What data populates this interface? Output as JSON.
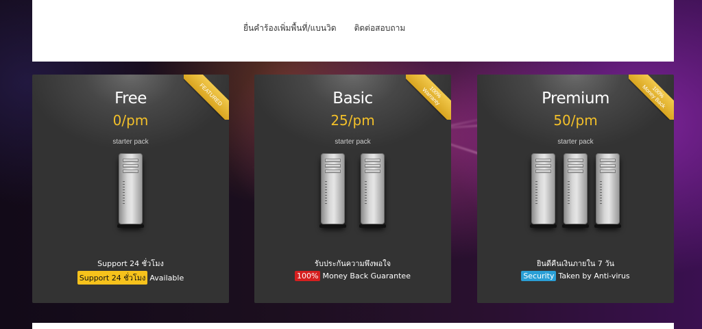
{
  "nav": {
    "items": [
      {
        "label": "ยื่นคำร้องเพิ่มพื้นที่/แบนวิด"
      },
      {
        "label": "ติดต่อสอบถาม"
      }
    ]
  },
  "plans": [
    {
      "name": "Free",
      "price": "0/pm",
      "subtitle": "starter pack",
      "ribbon": [
        "FEATURED"
      ],
      "servers": 1,
      "line1": "Support 24 ชั่วโมง",
      "badge": "Support 24 ชั่วโมง",
      "badge_color": "#f6c21c",
      "line2_rest": "Available"
    },
    {
      "name": "Basic",
      "price": "25/pm",
      "subtitle": "starter pack",
      "ribbon": [
        "100%",
        "Warranty"
      ],
      "servers": 2,
      "line1": "รับประกันความพึงพอใจ",
      "badge": "100%",
      "badge_color": "#d61f1f",
      "line2_rest": "Money Back Guarantee"
    },
    {
      "name": "Premium",
      "price": "50/pm",
      "subtitle": "starter pack",
      "ribbon": [
        "100%",
        "Money Back"
      ],
      "servers": 3,
      "line1": "ยินดีคืนเงินภายใน 7 วัน",
      "badge": "Security",
      "badge_color": "#2a9fd6",
      "line2_rest": "Taken by Anti-virus"
    }
  ],
  "colors": {
    "accent_price": "#f3c029",
    "ribbon": "#e3b031",
    "header_bg": "#ffffff"
  },
  "icons": {
    "server": "server-tower-icon"
  }
}
